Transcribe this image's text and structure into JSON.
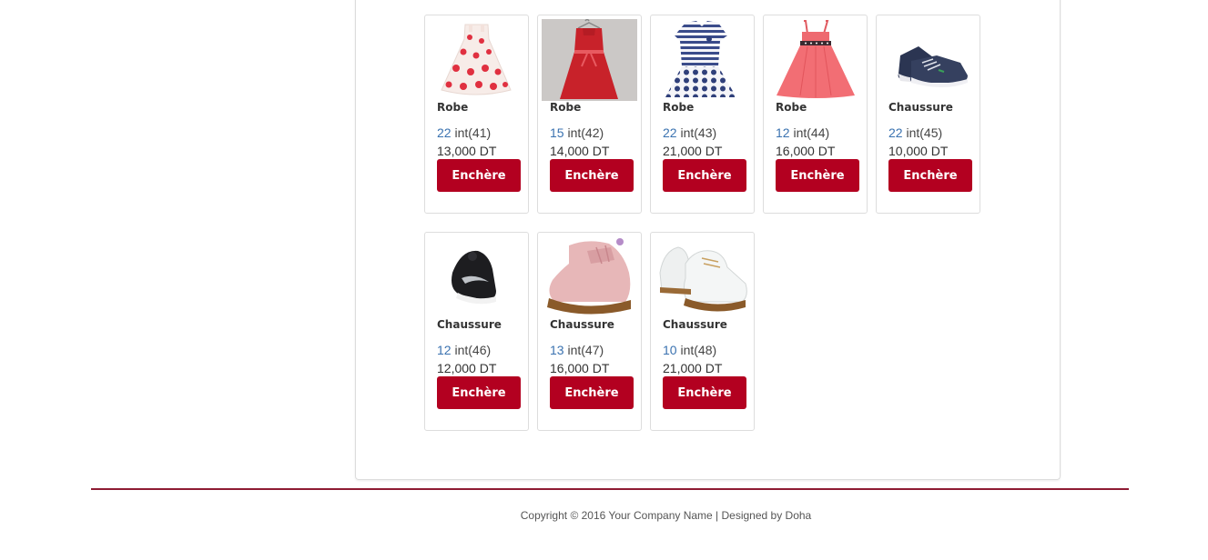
{
  "bid_button_label": "Enchère",
  "accent_color": "#b30020",
  "products": [
    {
      "name": "Robe",
      "count": "22",
      "int_label": "int(41)",
      "price": "13,000 DT",
      "image": "dress-white-polka-dots"
    },
    {
      "name": "Robe",
      "count": "15",
      "int_label": "int(42)",
      "price": "14,000 DT",
      "image": "dress-red-on-hanger"
    },
    {
      "name": "Robe",
      "count": "22",
      "int_label": "int(43)",
      "price": "21,000 DT",
      "image": "dress-navy-stripes"
    },
    {
      "name": "Robe",
      "count": "12",
      "int_label": "int(44)",
      "price": "16,000 DT",
      "image": "dress-pink"
    },
    {
      "name": "Chaussure",
      "count": "22",
      "int_label": "int(45)",
      "price": "10,000 DT",
      "image": "shoe-navy-sneaker"
    },
    {
      "name": "Chaussure",
      "count": "12",
      "int_label": "int(46)",
      "price": "12,000 DT",
      "image": "shoe-black-sneaker"
    },
    {
      "name": "Chaussure",
      "count": "13",
      "int_label": "int(47)",
      "price": "16,000 DT",
      "image": "shoe-pink-boot"
    },
    {
      "name": "Chaussure",
      "count": "10",
      "int_label": "int(48)",
      "price": "21,000 DT",
      "image": "shoe-white-boot"
    }
  ],
  "footer": {
    "copyright": "Copyright © 2016 Your Company Name | Designed by Doha"
  }
}
